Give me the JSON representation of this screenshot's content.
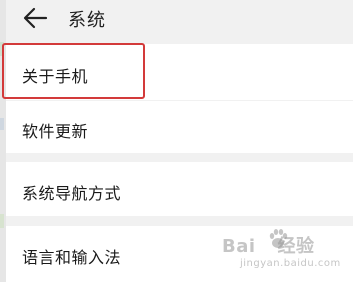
{
  "header": {
    "back_icon": "arrow-left-icon",
    "title": "系统"
  },
  "menu": [
    {
      "label": "关于手机"
    },
    {
      "label": "软件更新"
    },
    {
      "label": "系统导航方式"
    },
    {
      "label": "语言和输入法"
    }
  ],
  "highlight": {
    "color": "#d33a3a",
    "target": "关于手机"
  },
  "watermark": {
    "brand_prefix": "Bai",
    "brand_suffix": "经验",
    "url": "jingyan.baidu.com"
  }
}
